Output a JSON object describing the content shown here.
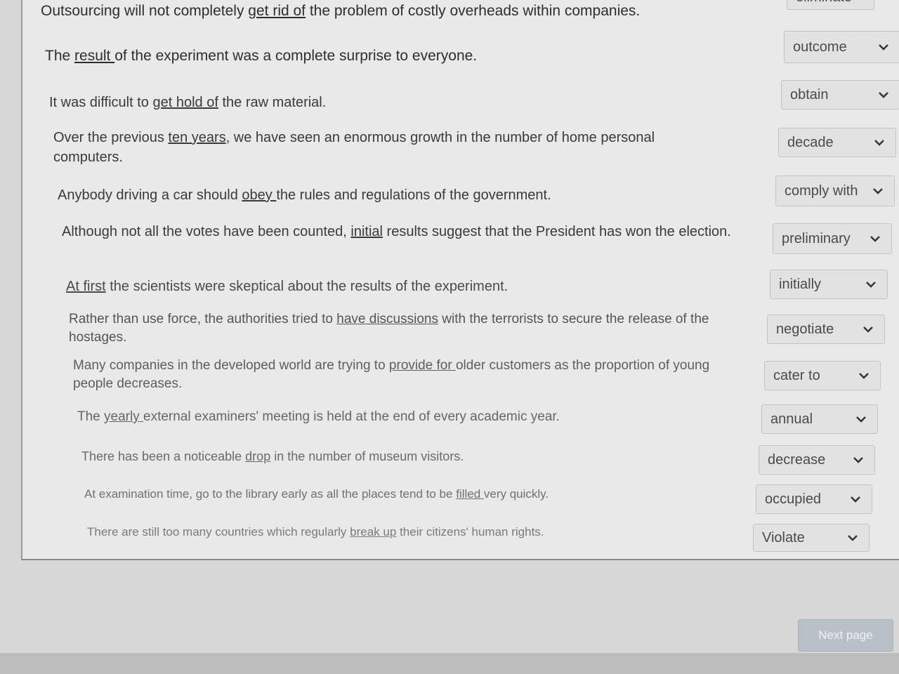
{
  "items": [
    {
      "before": "Outsourcing will not completely ",
      "underlined": "get rid of",
      "after": " the problem of costly overheads within companies.",
      "answer": "eliminate"
    },
    {
      "before": "The ",
      "underlined": "result ",
      "after": "of the experiment was a complete surprise to everyone.",
      "answer": "outcome"
    },
    {
      "before": "It was difficult to ",
      "underlined": "get hold of",
      "after": " the raw material.",
      "answer": "obtain"
    },
    {
      "before": "Over the previous ",
      "underlined": "ten years",
      "after": ", we have seen an enormous growth in the number of home personal computers.",
      "answer": "decade"
    },
    {
      "before": "Anybody driving a car should ",
      "underlined": "obey ",
      "after": "the rules and regulations of the government.",
      "answer": "comply with"
    },
    {
      "before": "Although not all the votes have been counted, ",
      "underlined": "initial",
      "after": " results suggest that the President has won the election.",
      "answer": "preliminary"
    },
    {
      "before": "",
      "underlined": "At first",
      "after": " the scientists were skeptical about the results of the experiment.",
      "answer": "initially"
    },
    {
      "before": "Rather than use force, the authorities tried to ",
      "underlined": "have discussions",
      "after": " with the terrorists to secure the release of the hostages.",
      "answer": "negotiate"
    },
    {
      "before": "Many companies in the developed world are trying to ",
      "underlined": "provide for ",
      "after": "older customers as the proportion of young people decreases.",
      "answer": "cater to"
    },
    {
      "before": "The ",
      "underlined": "yearly ",
      "after": "external examiners' meeting is held at the end of every academic year.",
      "answer": "annual"
    },
    {
      "before": "There has been a noticeable ",
      "underlined": "drop",
      "after": " in the number of museum visitors.",
      "answer": "decrease"
    },
    {
      "before": "At examination time, go to the library early as all the places tend to be ",
      "underlined": "filled ",
      "after": "very quickly.",
      "answer": "occupied"
    },
    {
      "before": "There are still too many countries which regularly ",
      "underlined": "break up",
      "after": " their citizens' human rights.",
      "answer": "Violate"
    }
  ],
  "next_button": "Next page"
}
